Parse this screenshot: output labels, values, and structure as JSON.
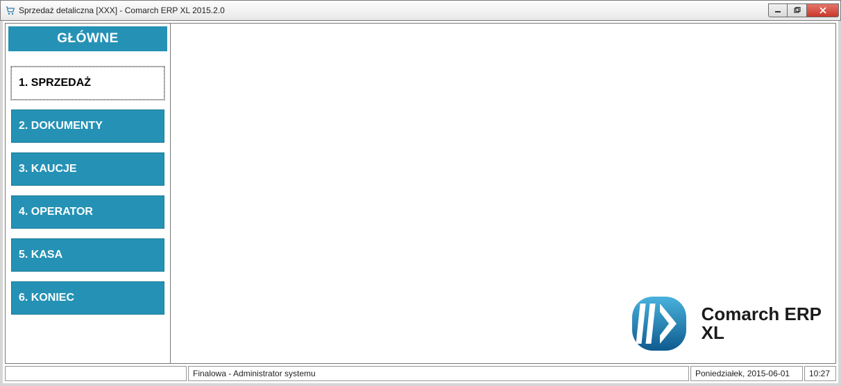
{
  "window": {
    "title": "Sprzedaż detaliczna [XXX] - Comarch ERP XL 2015.2.0"
  },
  "sidebar": {
    "header": "GŁÓWNE",
    "items": [
      {
        "label": "1. SPRZEDAŻ",
        "active": true
      },
      {
        "label": "2. DOKUMENTY",
        "active": false
      },
      {
        "label": "3. KAUCJE",
        "active": false
      },
      {
        "label": "4. OPERATOR",
        "active": false
      },
      {
        "label": "5. KASA",
        "active": false
      },
      {
        "label": "6. KONIEC",
        "active": false
      }
    ]
  },
  "branding": {
    "line1": "Comarch ERP",
    "line2": "XL"
  },
  "status": {
    "user": "Finalowa - Administrator systemu",
    "date": "Poniedziałek, 2015-06-01",
    "time": "10:27"
  }
}
